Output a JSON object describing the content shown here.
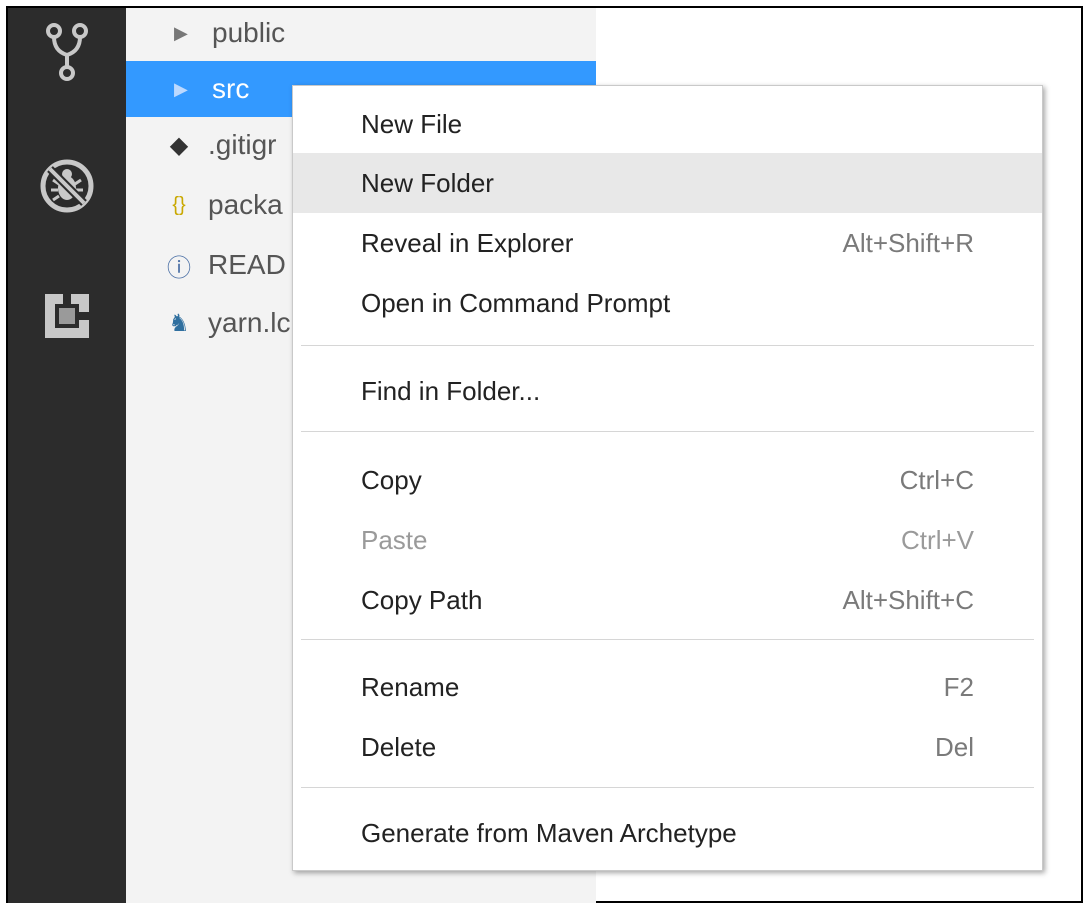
{
  "explorer": {
    "items": [
      {
        "label": "public",
        "icon": "chevron-right-icon",
        "selected": false
      },
      {
        "label": "src",
        "icon": "chevron-right-icon",
        "selected": true
      },
      {
        "label": ".gitigr",
        "icon": "git-icon",
        "icon_glyph": "◆",
        "icon_color": "#333333"
      },
      {
        "label": "packa",
        "icon": "json-braces-icon",
        "icon_glyph": "{}",
        "icon_color": "#c9a800"
      },
      {
        "label": "READ",
        "icon": "info-icon",
        "icon_glyph": "ⓘ",
        "icon_color": "#4a6fa5"
      },
      {
        "label": "yarn.lc",
        "icon": "yarn-cat-icon",
        "icon_glyph": "♞",
        "icon_color": "#2f6f9f"
      }
    ],
    "selection_color": "#3399ff"
  },
  "activity_bar": {
    "icons": [
      "source-control-icon",
      "no-debug-icon",
      "extensions-icon"
    ]
  },
  "context_menu": {
    "groups": [
      [
        {
          "label": "New File",
          "shortcut": ""
        },
        {
          "label": "New Folder",
          "shortcut": "",
          "hover": true
        },
        {
          "label": "Reveal in Explorer",
          "shortcut": "Alt+Shift+R"
        },
        {
          "label": "Open in Command Prompt",
          "shortcut": ""
        }
      ],
      [
        {
          "label": "Find in Folder...",
          "shortcut": ""
        }
      ],
      [
        {
          "label": "Copy",
          "shortcut": "Ctrl+C"
        },
        {
          "label": "Paste",
          "shortcut": "Ctrl+V",
          "disabled": true
        },
        {
          "label": "Copy Path",
          "shortcut": "Alt+Shift+C"
        }
      ],
      [
        {
          "label": "Rename",
          "shortcut": "F2"
        },
        {
          "label": "Delete",
          "shortcut": "Del"
        }
      ],
      [
        {
          "label": "Generate from Maven Archetype",
          "shortcut": ""
        }
      ]
    ]
  }
}
